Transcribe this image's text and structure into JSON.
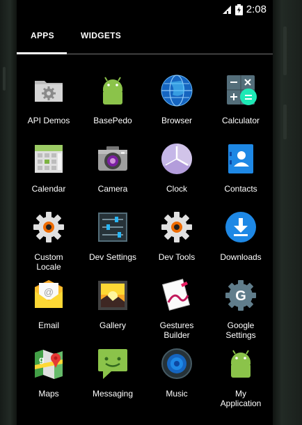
{
  "status": {
    "time": "2:08",
    "wifi_icon": "wifi-icon",
    "battery_icon": "battery-icon"
  },
  "tabs": [
    {
      "label": "APPS",
      "selected": true
    },
    {
      "label": "WIDGETS",
      "selected": false
    }
  ],
  "apps": [
    {
      "label": "API Demos",
      "icon": "api-demos-icon"
    },
    {
      "label": "BasePedo",
      "icon": "android-icon"
    },
    {
      "label": "Browser",
      "icon": "browser-globe-icon"
    },
    {
      "label": "Calculator",
      "icon": "calculator-icon"
    },
    {
      "label": "Calendar",
      "icon": "calendar-icon"
    },
    {
      "label": "Camera",
      "icon": "camera-icon"
    },
    {
      "label": "Clock",
      "icon": "clock-icon"
    },
    {
      "label": "Contacts",
      "icon": "contacts-icon"
    },
    {
      "label": "Custom\nLocale",
      "icon": "gear-icon"
    },
    {
      "label": "Dev Settings",
      "icon": "sliders-icon"
    },
    {
      "label": "Dev Tools",
      "icon": "gear-icon"
    },
    {
      "label": "Downloads",
      "icon": "download-icon"
    },
    {
      "label": "Email",
      "icon": "email-icon"
    },
    {
      "label": "Gallery",
      "icon": "gallery-icon"
    },
    {
      "label": "Gestures\nBuilder",
      "icon": "gestures-icon"
    },
    {
      "label": "Google\nSettings",
      "icon": "google-settings-icon"
    },
    {
      "label": "Maps",
      "icon": "maps-icon"
    },
    {
      "label": "Messaging",
      "icon": "messaging-icon"
    },
    {
      "label": "Music",
      "icon": "music-icon"
    },
    {
      "label": "My\nApplication",
      "icon": "android-icon"
    }
  ]
}
